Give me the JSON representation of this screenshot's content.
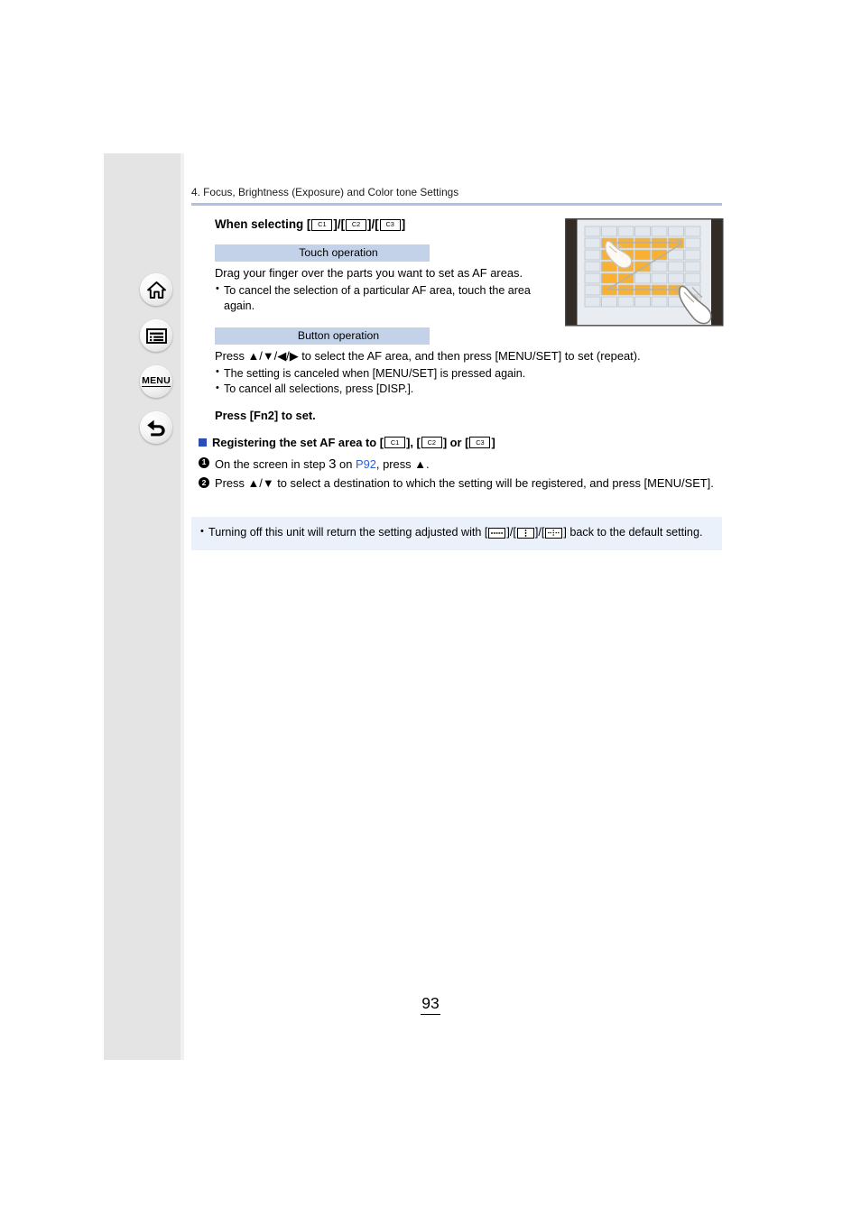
{
  "document": {
    "chapter_header": "4. Focus, Brightness (Exposure) and Color tone Settings",
    "page_number": "93"
  },
  "sidebar": {
    "buttons": [
      {
        "name": "home",
        "icon": "home-icon",
        "label": ""
      },
      {
        "name": "contents",
        "icon": "list-icon",
        "label": ""
      },
      {
        "name": "menu",
        "icon": "menu-text-icon",
        "label": "MENU"
      },
      {
        "name": "back",
        "icon": "back-arrow-icon",
        "label": ""
      }
    ]
  },
  "main": {
    "when_selecting": {
      "prefix": "When selecting [",
      "sep1": "]/[",
      "sep2": "]/[",
      "suffix": "]",
      "c1": "C1",
      "c2": "C2",
      "c3": "C3"
    },
    "touch_section": {
      "bar_label": "Touch operation",
      "paragraph": "Drag your finger over the parts you want to set as AF areas.",
      "bullets": [
        "To cancel the selection of a particular AF area, touch the area again."
      ]
    },
    "button_section": {
      "bar_label": "Button operation",
      "paragraph": "Press ▲/▼/◀/▶ to select the AF area, and then press [MENU/SET] to set (repeat).",
      "bullets": [
        "The setting is canceled when [MENU/SET] is pressed again.",
        "To cancel all selections, press [DISP.]."
      ],
      "bold_line": "Press [Fn2] to set."
    },
    "registering": {
      "heading_prefix": "Registering the set AF area to [",
      "heading_sep1": "], [",
      "heading_sep2": "] or [",
      "heading_suffix": "]",
      "c1": "C1",
      "c2": "C2",
      "c3": "C3",
      "steps": [
        {
          "num": "1",
          "text_before": "On the screen in step ",
          "step_number": "3",
          "text_mid": " on ",
          "page_ref": "P92",
          "text_after": ", press ▲."
        },
        {
          "num": "2",
          "text": "Press ▲/▼ to select a destination to which the setting will be registered, and press [MENU/SET]."
        }
      ]
    },
    "note": {
      "text_before": "Turning off this unit will return the setting adjusted with [",
      "sep1": "]/[",
      "sep2": "]/[",
      "text_after": "] back to the default setting."
    }
  },
  "illustration": {
    "name": "af-area-grid-touch-drag",
    "grid_columns": 7,
    "grid_rows": 7,
    "highlight_color": "#f8b133",
    "cell_color": "#e3e8ee",
    "bezel_color": "#332b26"
  },
  "colors": {
    "header_rule": "#aec1e0",
    "operation_bar": "#c3d2e8",
    "note_background": "#eaf1fa",
    "square_bullet": "#2b4db5",
    "page_link": "#2b5fd0",
    "sidebar": "#e4e4e4"
  }
}
